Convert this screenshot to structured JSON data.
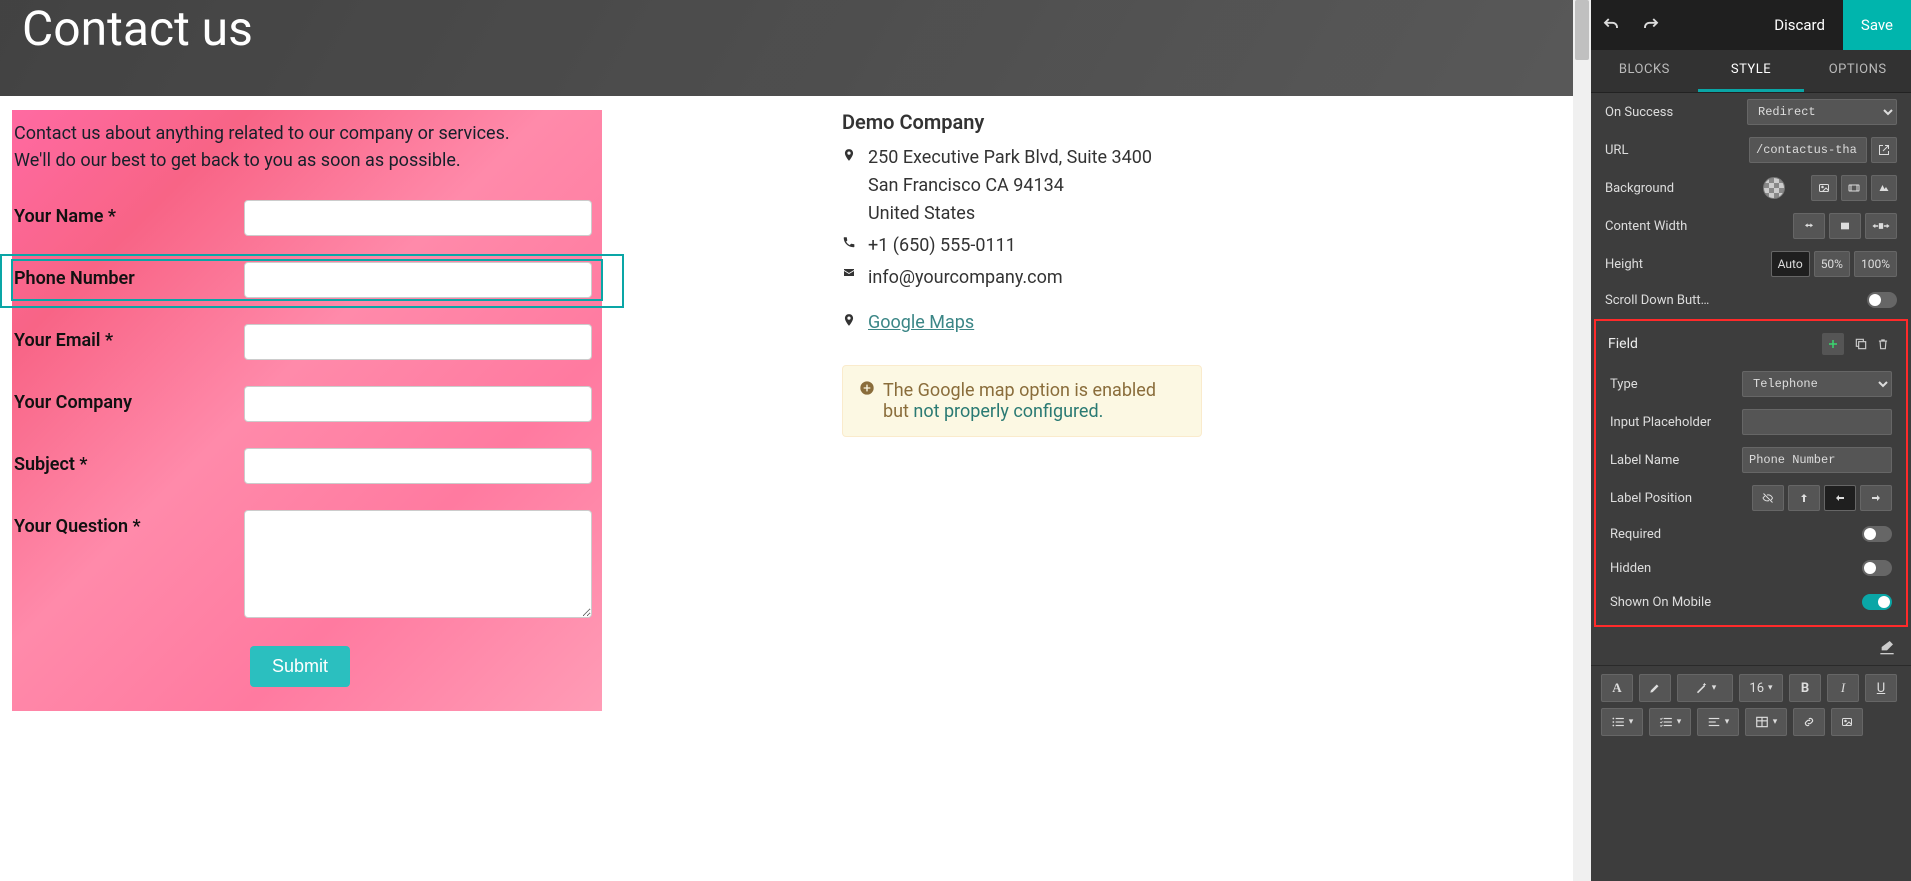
{
  "hero": {
    "title": "Contact us"
  },
  "form": {
    "intro_line1": "Contact us about anything related to our company or services.",
    "intro_line2": "We'll do our best to get back to you as soon as possible.",
    "fields": [
      {
        "label": "Your Name *",
        "type": "text",
        "selected": false
      },
      {
        "label": "Phone Number",
        "type": "text",
        "selected": true
      },
      {
        "label": "Your Email *",
        "type": "text",
        "selected": false
      },
      {
        "label": "Your Company",
        "type": "text",
        "selected": false
      },
      {
        "label": "Subject *",
        "type": "text",
        "selected": false
      },
      {
        "label": "Your Question *",
        "type": "textarea",
        "selected": false
      }
    ],
    "submit_label": "Submit"
  },
  "company": {
    "name": "Demo Company",
    "address1": "250 Executive Park Blvd, Suite 3400",
    "address2": "San Francisco CA 94134",
    "address3": "United States",
    "phone": "+1 (650) 555-0111",
    "email": "info@yourcompany.com",
    "maps_label": "Google Maps"
  },
  "alert": {
    "text_prefix": "The Google map option is enabled but ",
    "link_text": "not properly configured."
  },
  "sidebar": {
    "discard": "Discard",
    "save": "Save",
    "tabs": {
      "blocks": "BLOCKS",
      "style": "STYLE",
      "options": "OPTIONS"
    },
    "on_success": {
      "label": "On Success",
      "value": "Redirect"
    },
    "url": {
      "label": "URL",
      "value": "/contactus-tha"
    },
    "background": {
      "label": "Background"
    },
    "content_width": {
      "label": "Content Width"
    },
    "height": {
      "label": "Height",
      "opts": [
        "Auto",
        "50%",
        "100%"
      ]
    },
    "scroll_down": {
      "label": "Scroll Down Butt…"
    },
    "field_section": {
      "title": "Field",
      "type": {
        "label": "Type",
        "value": "Telephone"
      },
      "placeholder": {
        "label": "Input Placeholder",
        "value": ""
      },
      "label_name": {
        "label": "Label Name",
        "value": "Phone Number"
      },
      "label_position": {
        "label": "Label Position"
      },
      "required": {
        "label": "Required"
      },
      "hidden": {
        "label": "Hidden"
      },
      "shown_mobile": {
        "label": "Shown On Mobile"
      }
    },
    "rte": {
      "font_size": "16"
    }
  }
}
